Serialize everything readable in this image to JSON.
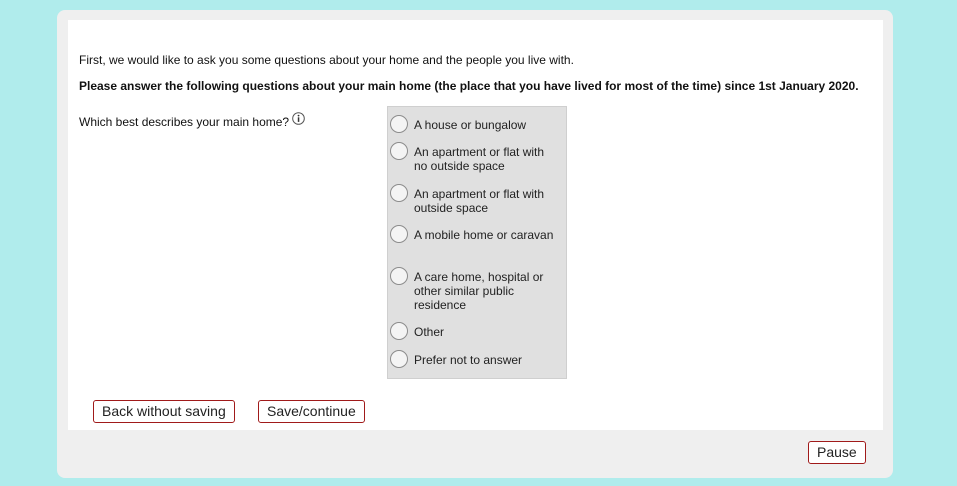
{
  "survey": {
    "intro": "First, we would like to ask you some questions about your home and the people you live with.",
    "instruction": "Please answer the following questions about your main home (the place that you have lived for most of the time) since 1st January 2020.",
    "question": "Which best describes your main home?",
    "info_icon": "info-icon",
    "options": [
      "A house or bungalow",
      "An apartment or flat with no outside space",
      "An apartment or flat with outside space",
      "A mobile home or caravan",
      "A care home, hospital or other similar public residence",
      "Other",
      "Prefer not to answer"
    ]
  },
  "buttons": {
    "back": "Back without saving",
    "save": "Save/continue",
    "pause": "Pause"
  },
  "colors": {
    "page_background": "#b0ecec",
    "button_border": "#a01a1a",
    "options_background": "#e0e0e0"
  }
}
